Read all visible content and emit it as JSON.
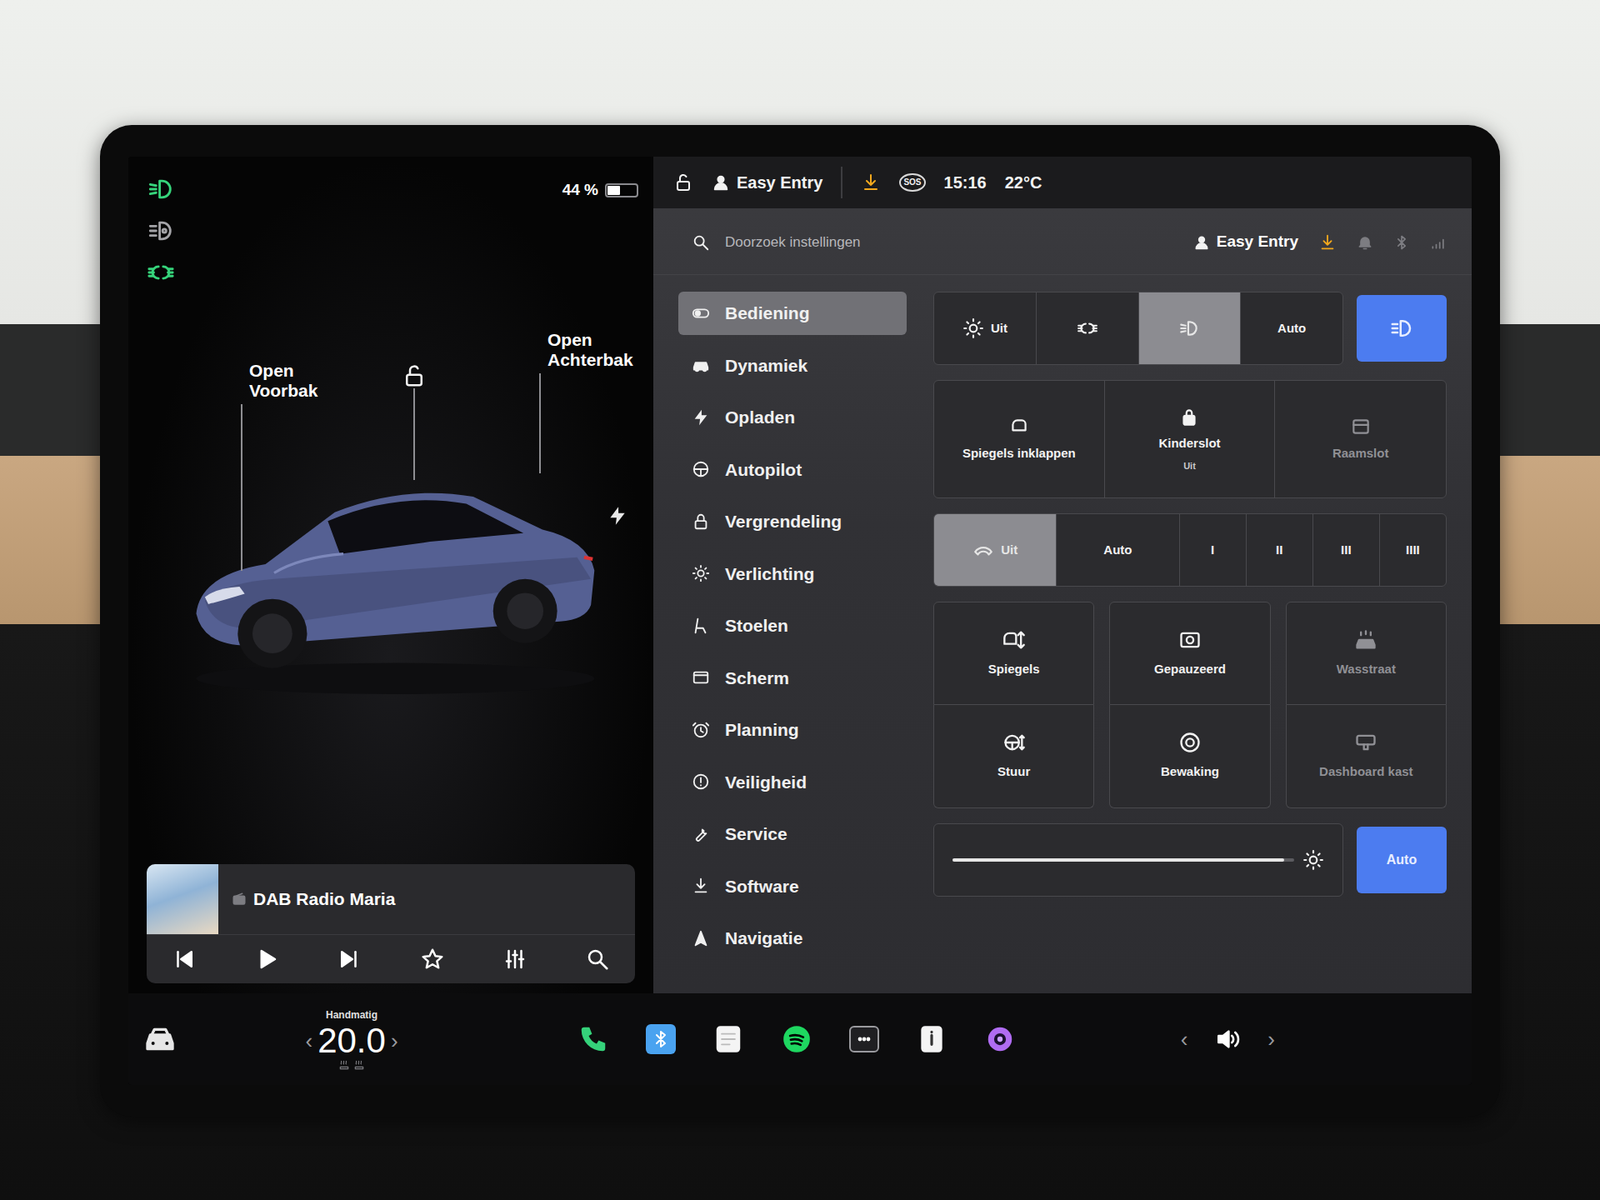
{
  "indicators": [
    {
      "kind": "low-beam",
      "on": true
    },
    {
      "kind": "auto-high-beam",
      "on": false
    },
    {
      "kind": "parking-lights",
      "on": true
    }
  ],
  "battery": {
    "reading": "44 %",
    "level": 0.44
  },
  "car": {
    "front_trunk": "Open Voorbak",
    "rear_trunk": "Open Achterbak",
    "locked": false,
    "charging": true
  },
  "media": {
    "title": "DAB Radio Maria",
    "favorite": false
  },
  "top_bar": {
    "locked": false,
    "profile": "Easy Entry",
    "update_available": true,
    "sos": "SOS",
    "time": "15:16",
    "temperature": "22°C"
  },
  "settings": {
    "search": {
      "placeholder": "Doorzoek instellingen"
    },
    "profile": "Easy Entry",
    "update_available": true
  },
  "menu": [
    {
      "label": "Bediening",
      "kind": "controls",
      "selected": true
    },
    {
      "label": "Dynamiek",
      "kind": "car",
      "selected": false
    },
    {
      "label": "Opladen",
      "kind": "bolt",
      "selected": false
    },
    {
      "label": "Autopilot",
      "kind": "steering",
      "selected": false
    },
    {
      "label": "Vergrendeling",
      "kind": "lock",
      "selected": false
    },
    {
      "label": "Verlichting",
      "kind": "sun",
      "selected": false
    },
    {
      "label": "Stoelen",
      "kind": "seat",
      "selected": false
    },
    {
      "label": "Scherm",
      "kind": "screen",
      "selected": false
    },
    {
      "label": "Planning",
      "kind": "clock",
      "selected": false
    },
    {
      "label": "Veiligheid",
      "kind": "alert",
      "selected": false
    },
    {
      "label": "Service",
      "kind": "wrench",
      "selected": false
    },
    {
      "label": "Software",
      "kind": "download",
      "selected": false
    },
    {
      "label": "Navigatie",
      "kind": "nav",
      "selected": false
    }
  ],
  "headlights": {
    "options": [
      {
        "label": "Uit",
        "kind": "sun-label",
        "selected": false
      },
      {
        "kind": "parking-lights",
        "selected": false
      },
      {
        "kind": "low-beam",
        "selected": true
      },
      {
        "label": "Auto",
        "kind": "label",
        "selected": false
      }
    ],
    "high_beam": {
      "kind": "high-beam",
      "on": true
    }
  },
  "tiles_top": [
    {
      "label": "Spiegels inklappen",
      "kind": "mirror-fold",
      "disabled": false
    },
    {
      "label": "Kinderslot",
      "sub": "Uit",
      "kind": "child-lock",
      "disabled": false
    },
    {
      "label": "Raamslot",
      "kind": "window-lock",
      "disabled": true
    }
  ],
  "wipers": [
    {
      "label": "Uit",
      "kind": "wiper-label",
      "selected": true
    },
    {
      "label": "Auto",
      "kind": "label",
      "selected": false
    },
    {
      "label": "I",
      "kind": "label",
      "selected": false
    },
    {
      "label": "II",
      "kind": "label",
      "selected": false
    },
    {
      "label": "III",
      "kind": "label",
      "selected": false
    },
    {
      "label": "IIII",
      "kind": "label",
      "selected": false
    }
  ],
  "tiles_bottom": [
    {
      "label": "Spiegels",
      "kind": "mirror-adjust",
      "disabled": false
    },
    {
      "label": "Gepauzeerd",
      "kind": "dashcam",
      "disabled": false
    },
    {
      "label": "Wasstraat",
      "kind": "car-wash",
      "disabled": true
    },
    {
      "label": "Stuur",
      "kind": "steering-adjust",
      "disabled": false
    },
    {
      "label": "Bewaking",
      "kind": "sentry",
      "disabled": false
    },
    {
      "label": "Dashboard kast",
      "kind": "glovebox",
      "disabled": true
    }
  ],
  "brightness": {
    "level": 0.97,
    "auto": {
      "label": "Auto",
      "selected": true
    }
  },
  "bottom_bar": {
    "climate_mode": "Handmatig",
    "temperature": "20.0",
    "decrease": "‹",
    "increase": "›",
    "apps": [
      {
        "kind": "phone"
      },
      {
        "kind": "bluetooth-app"
      },
      {
        "kind": "notes"
      },
      {
        "kind": "spotify"
      },
      {
        "kind": "more"
      },
      {
        "kind": "manual"
      },
      {
        "kind": "camera"
      }
    ],
    "volume_down": "‹",
    "volume_up": "›"
  }
}
